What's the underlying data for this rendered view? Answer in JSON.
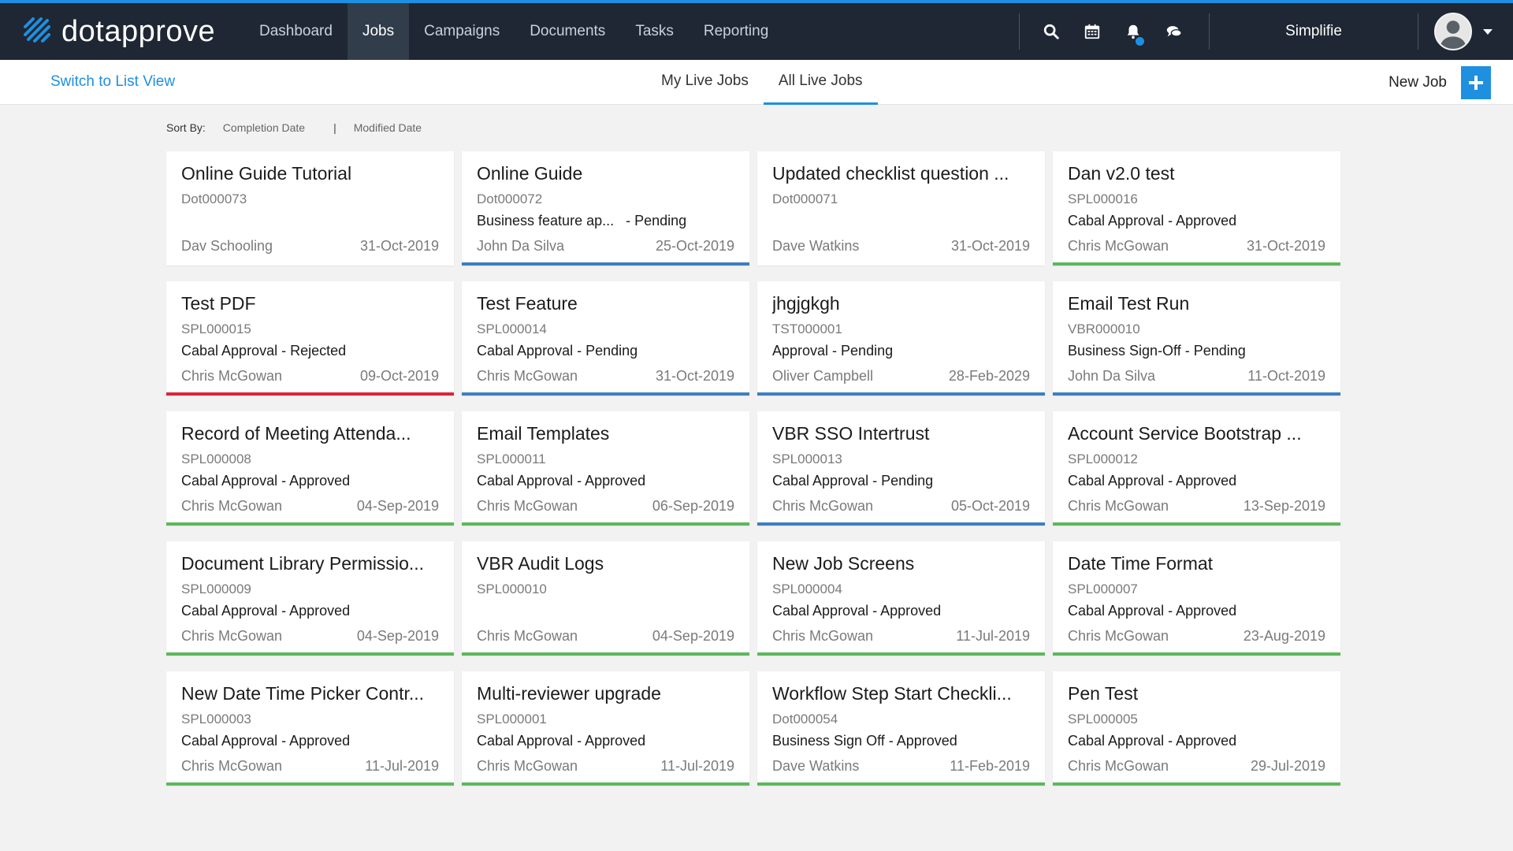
{
  "app": {
    "logo_text": "dotapprove",
    "accent": "#1f8fe0",
    "nav": [
      {
        "label": "Dashboard",
        "active": false
      },
      {
        "label": "Jobs",
        "active": true
      },
      {
        "label": "Campaigns",
        "active": false
      },
      {
        "label": "Documents",
        "active": false
      },
      {
        "label": "Tasks",
        "active": false
      },
      {
        "label": "Reporting",
        "active": false
      }
    ],
    "icons": [
      "search-icon",
      "calendar-icon",
      "bell-icon",
      "chat-icon"
    ],
    "org_name": "Simplifie"
  },
  "subbar": {
    "switch_view": "Switch to List View",
    "tabs": [
      {
        "label": "My Live Jobs",
        "active": false
      },
      {
        "label": "All Live Jobs",
        "active": true
      }
    ],
    "new_job_label": "New Job",
    "new_job_icon": "plus-icon"
  },
  "sort": {
    "label": "Sort By:",
    "options": [
      "Completion Date",
      "Modified Date"
    ],
    "separator": "|"
  },
  "status_colors": {
    "approved": "#5cb85c",
    "pending": "#3d7ebf",
    "rejected": "#d9253a",
    "none": "transparent"
  },
  "cards": [
    {
      "title": "Online Guide Tutorial",
      "code": "Dot000073",
      "status": "",
      "owner": "Dav Schooling",
      "date": "31-Oct-2019",
      "bar": "none"
    },
    {
      "title": "Online Guide",
      "code": "Dot000072",
      "status": "Business feature ap...   - Pending",
      "owner": "John Da Silva",
      "date": "25-Oct-2019",
      "bar": "pending"
    },
    {
      "title": "Updated checklist question ...",
      "code": "Dot000071",
      "status": "",
      "owner": "Dave Watkins",
      "date": "31-Oct-2019",
      "bar": "none"
    },
    {
      "title": "Dan v2.0 test",
      "code": "SPL000016",
      "status": "Cabal Approval - Approved",
      "owner": "Chris McGowan",
      "date": "31-Oct-2019",
      "bar": "approved"
    },
    {
      "title": "Test PDF",
      "code": "SPL000015",
      "status": "Cabal Approval - Rejected",
      "owner": "Chris McGowan",
      "date": "09-Oct-2019",
      "bar": "rejected"
    },
    {
      "title": "Test Feature",
      "code": "SPL000014",
      "status": "Cabal Approval - Pending",
      "owner": "Chris McGowan",
      "date": "31-Oct-2019",
      "bar": "pending"
    },
    {
      "title": "jhgjgkgh",
      "code": "TST000001",
      "status": "Approval - Pending",
      "owner": "Oliver Campbell",
      "date": "28-Feb-2029",
      "bar": "pending"
    },
    {
      "title": "Email Test Run",
      "code": "VBR000010",
      "status": "Business Sign-Off - Pending",
      "owner": "John Da Silva",
      "date": "11-Oct-2019",
      "bar": "pending"
    },
    {
      "title": "Record of Meeting Attenda...",
      "code": "SPL000008",
      "status": "Cabal Approval - Approved",
      "owner": "Chris McGowan",
      "date": "04-Sep-2019",
      "bar": "approved"
    },
    {
      "title": "Email Templates",
      "code": "SPL000011",
      "status": "Cabal Approval - Approved",
      "owner": "Chris McGowan",
      "date": "06-Sep-2019",
      "bar": "approved"
    },
    {
      "title": "VBR SSO Intertrust",
      "code": "SPL000013",
      "status": "Cabal Approval - Pending",
      "owner": "Chris McGowan",
      "date": "05-Oct-2019",
      "bar": "pending"
    },
    {
      "title": "Account Service Bootstrap ...",
      "code": "SPL000012",
      "status": "Cabal Approval - Approved",
      "owner": "Chris McGowan",
      "date": "13-Sep-2019",
      "bar": "approved"
    },
    {
      "title": "Document Library Permissio...",
      "code": "SPL000009",
      "status": "Cabal Approval - Approved",
      "owner": "Chris McGowan",
      "date": "04-Sep-2019",
      "bar": "approved"
    },
    {
      "title": "VBR Audit Logs",
      "code": "SPL000010",
      "status": "",
      "owner": "Chris McGowan",
      "date": "04-Sep-2019",
      "bar": "approved"
    },
    {
      "title": "New Job Screens",
      "code": "SPL000004",
      "status": "Cabal Approval - Approved",
      "owner": "Chris McGowan",
      "date": "11-Jul-2019",
      "bar": "approved"
    },
    {
      "title": "Date Time Format",
      "code": "SPL000007",
      "status": "Cabal Approval - Approved",
      "owner": "Chris McGowan",
      "date": "23-Aug-2019",
      "bar": "approved"
    },
    {
      "title": "New Date Time Picker Contr...",
      "code": "SPL000003",
      "status": "Cabal Approval - Approved",
      "owner": "Chris McGowan",
      "date": "11-Jul-2019",
      "bar": "approved"
    },
    {
      "title": "Multi-reviewer upgrade",
      "code": "SPL000001",
      "status": "Cabal Approval - Approved",
      "owner": "Chris McGowan",
      "date": "11-Jul-2019",
      "bar": "approved"
    },
    {
      "title": "Workflow Step Start Checkli...",
      "code": "Dot000054",
      "status": "Business Sign Off - Approved",
      "owner": "Dave Watkins",
      "date": "11-Feb-2019",
      "bar": "approved"
    },
    {
      "title": "Pen Test",
      "code": "SPL000005",
      "status": "Cabal Approval - Approved",
      "owner": "Chris McGowan",
      "date": "29-Jul-2019",
      "bar": "approved"
    }
  ]
}
